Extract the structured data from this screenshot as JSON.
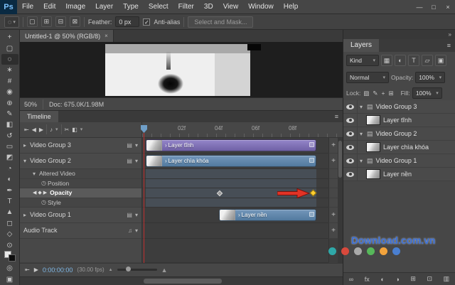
{
  "app": {
    "logo": "Ps"
  },
  "window_controls": {
    "minimize": "—",
    "maximize": "□",
    "close": "×"
  },
  "menubar": {
    "items": [
      "File",
      "Edit",
      "Image",
      "Layer",
      "Type",
      "Select",
      "Filter",
      "3D",
      "View",
      "Window",
      "Help"
    ]
  },
  "options_bar": {
    "tool_glyph": "◌",
    "mode_glyphs": [
      "▢",
      "⊞",
      "⊟",
      "⊠"
    ],
    "feather_label": "Feather:",
    "feather_value": "0 px",
    "antialias_label": "Anti-alias",
    "select_and_mask": "Select and Mask..."
  },
  "document": {
    "tab_title": "Untitled-1 @ 50% (RGB/8)",
    "zoom": "50%",
    "doc_info": "Doc: 675.0K/1.98M"
  },
  "toolbar": {
    "tools": [
      {
        "name": "move",
        "glyph": "+"
      },
      {
        "name": "marquee",
        "glyph": "▢"
      },
      {
        "name": "lasso",
        "glyph": "◌"
      },
      {
        "name": "quick-selection",
        "glyph": "∗"
      },
      {
        "name": "crop",
        "glyph": "#"
      },
      {
        "name": "eyedropper",
        "glyph": "◉"
      },
      {
        "name": "healing-brush",
        "glyph": "⊕"
      },
      {
        "name": "brush",
        "glyph": "✎"
      },
      {
        "name": "clone-stamp",
        "glyph": "◧"
      },
      {
        "name": "history-brush",
        "glyph": "↺"
      },
      {
        "name": "eraser",
        "glyph": "▭"
      },
      {
        "name": "gradient",
        "glyph": "◩"
      },
      {
        "name": "blur",
        "glyph": "◔"
      },
      {
        "name": "dodge",
        "glyph": "◐"
      },
      {
        "name": "pen",
        "glyph": "✒"
      },
      {
        "name": "type",
        "glyph": "T"
      },
      {
        "name": "path-selection",
        "glyph": "▲"
      },
      {
        "name": "shape",
        "glyph": "◻"
      },
      {
        "name": "hand",
        "glyph": "◇"
      },
      {
        "name": "zoom",
        "glyph": "⊙"
      }
    ]
  },
  "icons": {
    "dropdown": "▾",
    "caret_right": "▸",
    "caret_down": "▾",
    "plus": "+",
    "panel_menu": "≡",
    "collapse": "»",
    "goto_start": "⇤",
    "prev_frame": "◀",
    "play": "▶",
    "audio": "♪",
    "music": "♫",
    "scissors": "✂",
    "transition": "◧",
    "film": "▤",
    "clip_arrow": "›",
    "stopwatch": "◷",
    "nav_left": "◀",
    "nav_right": "▶",
    "keyframe": "◆",
    "mountain": "▲",
    "close": "×",
    "check": "✓",
    "quickmask": "◎",
    "screen": "▣"
  },
  "timeline": {
    "tab": "Timeline",
    "ruler_ticks": [
      "02f",
      "04f",
      "06f",
      "08f"
    ],
    "tracks": {
      "group3": {
        "label": "Video Group 3",
        "clip": "Layer tĩnh"
      },
      "group2": {
        "label": "Video Group 2",
        "clip": "Layer chìa khóa"
      },
      "altered": {
        "label": "Altered Video"
      },
      "position": {
        "label": "Position"
      },
      "opacity": {
        "label": "Opacity"
      },
      "style": {
        "label": "Style"
      },
      "group1": {
        "label": "Video Group 1",
        "clip": "Layer nền"
      },
      "audio": {
        "label": "Audio Track"
      }
    },
    "footer": {
      "timecode": "0:00:00:00",
      "fps": "(30.00 fps)"
    }
  },
  "layers_panel": {
    "tab": "Layers",
    "kind": "Kind",
    "filter_icons": [
      "▦",
      "◐",
      "T",
      "▱",
      "▣"
    ],
    "blend_mode": "Normal",
    "opacity_label": "Opacity:",
    "opacity_value": "100%",
    "lock_label": "Lock:",
    "lock_icons": [
      "▨",
      "✎",
      "+",
      "⊞"
    ],
    "fill_label": "Fill:",
    "fill_value": "100%",
    "rows": [
      {
        "label": "Video Group 3"
      },
      {
        "label": "Layer tĩnh"
      },
      {
        "label": "Video Group 2"
      },
      {
        "label": "Layer chìa khóa"
      },
      {
        "label": "Video Group 1"
      },
      {
        "label": "Layer nền"
      }
    ],
    "bottom_icons": [
      {
        "name": "link",
        "glyph": "∞"
      },
      {
        "name": "fx",
        "glyph": "fx"
      },
      {
        "name": "mask",
        "glyph": "◐"
      },
      {
        "name": "adjustment",
        "glyph": "◑"
      },
      {
        "name": "group",
        "glyph": "⊞"
      },
      {
        "name": "new-layer",
        "glyph": "⊡"
      },
      {
        "name": "delete",
        "glyph": "▥"
      }
    ]
  },
  "watermark": {
    "text": "Download.com.vn",
    "dot_colors": [
      "#2fa8a8",
      "#d8493c",
      "#a9a9a9",
      "#57b85a",
      "#f2a33c",
      "#4a7fd0"
    ]
  },
  "colors": {
    "clip_purple": "#7b6cb4",
    "clip_blue": "#5f86ad",
    "keyframe_yellow": "#ffcf30",
    "arrow_red": "#e23326",
    "timecode_blue": "#7fb8e6"
  }
}
